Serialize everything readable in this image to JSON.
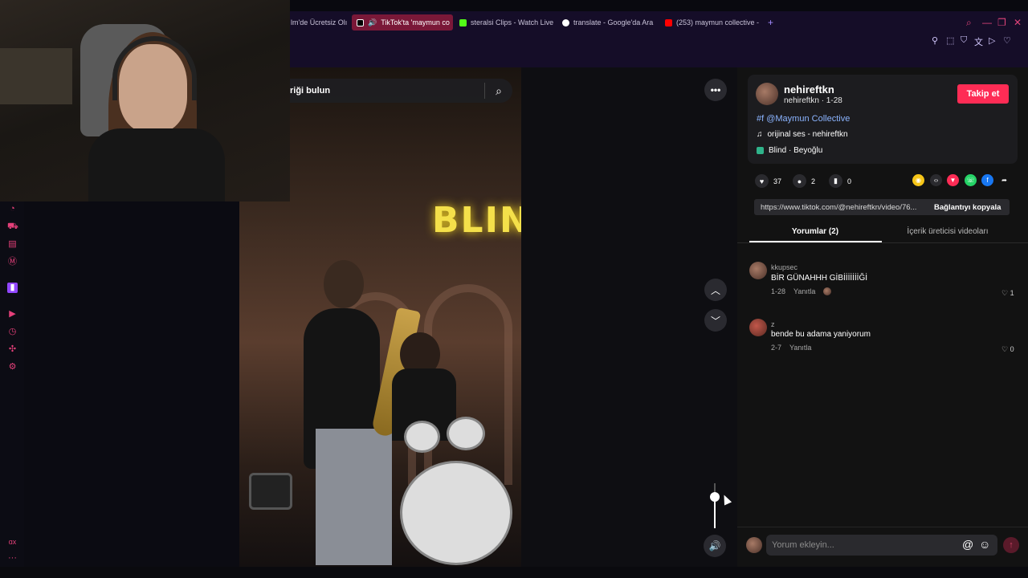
{
  "tabs": [
    {
      "label": "lm'de Ücretsiz Olı",
      "icon": "prime-icon",
      "color": "#4a7bd0",
      "active": false
    },
    {
      "label": "TikTok'ta 'maymun co",
      "icon": "tiktok-icon",
      "color": "#ffffff",
      "active": true
    },
    {
      "label": "steralsi Clips - Watch Live",
      "icon": "kick-icon",
      "color": "#53fc18",
      "active": false
    },
    {
      "label": "translate - Google'da Ara",
      "icon": "google-icon",
      "color": "#e8e8e8",
      "active": false
    },
    {
      "label": "(253) maymun collective -",
      "icon": "youtube-icon",
      "color": "#ff0000",
      "active": false
    }
  ],
  "new_tab": "+",
  "search": {
    "text": "riği bulun"
  },
  "video": {
    "neon_sign": "BLIND"
  },
  "author": {
    "name": "nehireftkn",
    "meta": "nehireftkn · 1-28",
    "follow": "Takip et"
  },
  "hashtag": "#f @Maymun Collective",
  "music": "orijinal ses - nehireftkn",
  "location": "Blind · Beyoğlu",
  "stats": {
    "likes": "37",
    "comments": "2",
    "saves": "0"
  },
  "link": {
    "url": "https://www.tiktok.com/@nehireftkn/video/76...",
    "copy": "Bağlantıyı kopyala"
  },
  "panel_tabs": {
    "comments": "Yorumlar (2)",
    "creator": "İçerik üreticisi videoları"
  },
  "comments": [
    {
      "user": "kkupsec",
      "text": "BİR GÜNAHHH GİBİİİİİİİĞİ",
      "date": "1-28",
      "reply": "Yanıtla",
      "likes": "1"
    },
    {
      "user": "z",
      "text": "bende bu adama yaniyorum",
      "date": "2-7",
      "reply": "Yanıtla",
      "likes": "0"
    }
  ],
  "comment_input": {
    "placeholder": "Yorum ekleyin..."
  },
  "sidebar_bottom": "ɑx",
  "sidebar_more": "···",
  "volume": {
    "level": 0.7
  },
  "colors": {
    "accent": "#fe2c55",
    "link": "#8bb4ff",
    "sidebar_icon": "#e5407a",
    "tabbar": "#150d28"
  }
}
